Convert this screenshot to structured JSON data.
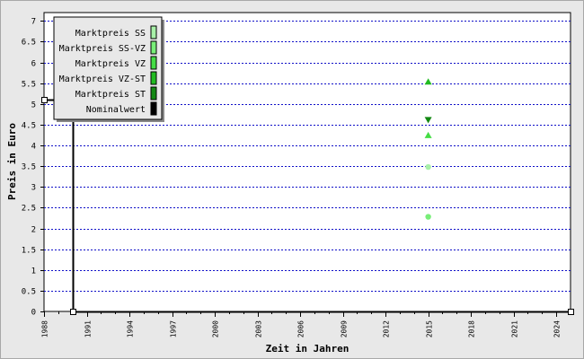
{
  "chart_data": {
    "type": "scatter",
    "title": "",
    "xlabel": "Zeit in Jahren",
    "ylabel": "Preis in Euro",
    "xlim": [
      1988,
      2025
    ],
    "ylim": [
      0,
      7.2
    ],
    "x_ticks": [
      "1988",
      "1991",
      "1994",
      "1997",
      "2000",
      "2003",
      "2006",
      "2009",
      "2012",
      "2015",
      "2018",
      "2021",
      "2024"
    ],
    "y_ticks": [
      "0",
      "0.5",
      "1",
      "1.5",
      "2",
      "2.5",
      "3",
      "3.5",
      "4",
      "4.5",
      "5",
      "5.5",
      "6",
      "6.5",
      "7"
    ],
    "grid": true,
    "legend_position": "top-left",
    "series": [
      {
        "name": "Marktpreis SS",
        "color": "#a8f0a8",
        "marker": "circle",
        "points": [
          {
            "x": 2015,
            "y": 3.48
          }
        ]
      },
      {
        "name": "Marktpreis SS-VZ",
        "color": "#78ee78",
        "marker": "circle",
        "points": [
          {
            "x": 2015,
            "y": 2.28
          }
        ]
      },
      {
        "name": "Marktpreis VZ",
        "color": "#44dd44",
        "marker": "triangle-up",
        "points": [
          {
            "x": 2015,
            "y": 4.24
          }
        ]
      },
      {
        "name": "Marktpreis VZ-ST",
        "color": "#22bb22",
        "marker": "triangle-up",
        "points": [
          {
            "x": 2015,
            "y": 5.53
          }
        ]
      },
      {
        "name": "Marktpreis ST",
        "color": "#128812",
        "marker": "triangle-down",
        "points": [
          {
            "x": 2015,
            "y": 4.62
          }
        ]
      },
      {
        "name": "Nominalwert",
        "color": "#000000",
        "marker": "line",
        "points": [
          {
            "x": 1988,
            "y": 5.11
          },
          {
            "x": 1990,
            "y": 5.11
          },
          {
            "x": 1990,
            "y": 0
          },
          {
            "x": 2025,
            "y": 0
          }
        ]
      }
    ]
  }
}
